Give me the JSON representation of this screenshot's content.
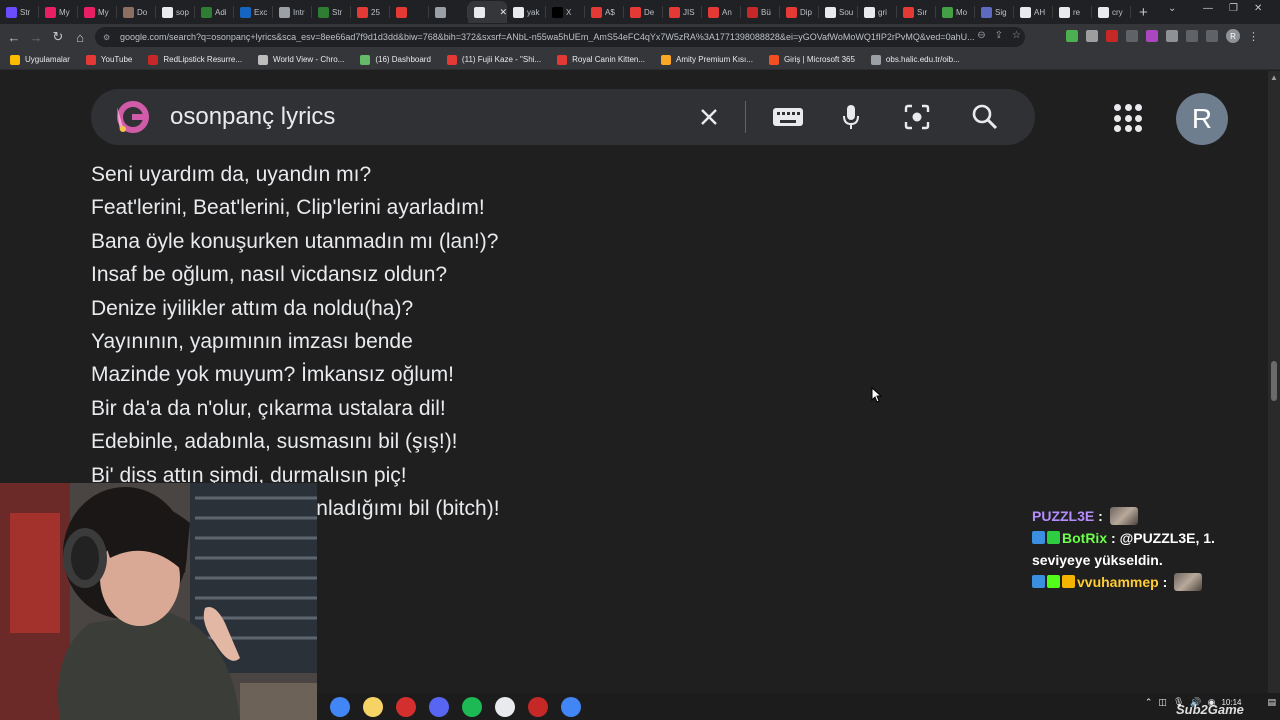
{
  "browser": {
    "tabs": [
      {
        "label": "Str",
        "color": "#6c4cff"
      },
      {
        "label": "My",
        "color": "#e91e63"
      },
      {
        "label": "My",
        "color": "#e91e63"
      },
      {
        "label": "Do",
        "color": "#8d6e63"
      },
      {
        "label": "sop",
        "color": "#e8eaed"
      },
      {
        "label": "Adi",
        "color": "#2e7d32"
      },
      {
        "label": "Exc",
        "color": "#1565c0"
      },
      {
        "label": "Intr",
        "color": "#9aa0a6"
      },
      {
        "label": "Str",
        "color": "#2e7d32"
      },
      {
        "label": "25",
        "color": "#e53935"
      },
      {
        "label": "",
        "color": "#e53935"
      },
      {
        "label": "",
        "color": "#9aa0a6"
      },
      {
        "label": "",
        "color": "#e8eaed",
        "active": true
      },
      {
        "label": "yak",
        "color": "#e8eaed"
      },
      {
        "label": "X",
        "color": "#000000"
      },
      {
        "label": "A$",
        "color": "#e53935"
      },
      {
        "label": "De",
        "color": "#e53935"
      },
      {
        "label": "JIS",
        "color": "#e53935"
      },
      {
        "label": "An",
        "color": "#e53935"
      },
      {
        "label": "Bü",
        "color": "#c62828"
      },
      {
        "label": "Dip",
        "color": "#e53935"
      },
      {
        "label": "Sou",
        "color": "#e8eaed"
      },
      {
        "label": "gri",
        "color": "#e8eaed"
      },
      {
        "label": "Sır",
        "color": "#e53935"
      },
      {
        "label": "Mo",
        "color": "#43a047"
      },
      {
        "label": "Sig",
        "color": "#5c6bc0"
      },
      {
        "label": "AH",
        "color": "#e8eaed"
      },
      {
        "label": "re",
        "color": "#e8eaed"
      },
      {
        "label": "cry",
        "color": "#e8eaed"
      }
    ],
    "new_tab": "+",
    "url": "google.com/search?q=osonpanç+lyrics&sca_esv=8ee66ad7f9d1d3dd&biw=768&bih=372&sxsrf=ANbL-n55wa5hUEm_AmS54eFC4qYx7W5zRA%3A1771398088828&ei=yGOVafWoMoWQ1fIP2rPvMQ&ved=0ahU...",
    "bookmarks": [
      {
        "label": "Uygulamalar",
        "color": "#fbbc04"
      },
      {
        "label": "YouTube",
        "color": "#e53935"
      },
      {
        "label": "RedLipstick Resurre...",
        "color": "#c62828"
      },
      {
        "label": "World View - Chro...",
        "color": "#bdbdbd"
      },
      {
        "label": "(16) Dashboard",
        "color": "#66bb6a"
      },
      {
        "label": "(11) Fujii Kaze - \"Shi...",
        "color": "#e53935"
      },
      {
        "label": "Royal Canin Kitten...",
        "color": "#e53935"
      },
      {
        "label": "Amity Premium Kısı...",
        "color": "#f9a825"
      },
      {
        "label": "Giriş | Microsoft 365",
        "color": "#f25022"
      },
      {
        "label": "obs.halic.edu.tr/oib...",
        "color": "#9aa0a6"
      }
    ]
  },
  "search": {
    "query": "osonpanç lyrics"
  },
  "account": {
    "initial": "R"
  },
  "lyrics": [
    "Seni uyardım da, uyandın mı?",
    "Feat'lerini, Beat'lerini, Clip'lerini ayarladım!",
    "Bana öyle konuşurken utanmadın mı (lan!)?",
    "Insaf be oğlum, nasıl vicdansız oldun?",
    "Denize iyilikler attım da noldu(ha)?",
    "Yayınının, yapımının imzası bende",
    "Mazinde yok muyum? İmkansız oğlum!",
    "Bir da'a da n'olur, çıkarma ustalara dil!",
    "Edebinle, adabınla, susmasını bil (şış!)!",
    "Bi' diss attın şimdi, durmalısın piç!",
    "Bu kadarını biliyorsan, anladığımı bil (bitch)!"
  ],
  "chat": [
    {
      "user": "PUZZL3E",
      "user_color": "#b48cff",
      "separator": " :",
      "message": "",
      "badges": [],
      "emote": true
    },
    {
      "user": "BotRix",
      "user_color": "#6cff4a",
      "separator": " :",
      "message": "@PUZZL3E, 1. seviyeye yükseldin.",
      "badges": [
        "#3b8fe0",
        "#2ecc40"
      ],
      "emote": false
    },
    {
      "user": "vvuhammep",
      "user_color": "#ffcc33",
      "separator": " :",
      "message": "",
      "badges": [
        "#3b8fe0",
        "#53fc18",
        "#f5b400"
      ],
      "emote": true
    }
  ],
  "taskbar": {
    "apps": [
      {
        "name": "chrome",
        "color": "#4285f4"
      },
      {
        "name": "files",
        "color": "#f6d365"
      },
      {
        "name": "video",
        "color": "#d32f2f"
      },
      {
        "name": "discord",
        "color": "#5865f2"
      },
      {
        "name": "spotify",
        "color": "#1db954"
      },
      {
        "name": "obs",
        "color": "#e8eaed"
      },
      {
        "name": "app7",
        "color": "#c62828"
      },
      {
        "name": "chrome-2",
        "color": "#4285f4"
      }
    ],
    "time": "10:14"
  },
  "watermark": "Sub2Game"
}
